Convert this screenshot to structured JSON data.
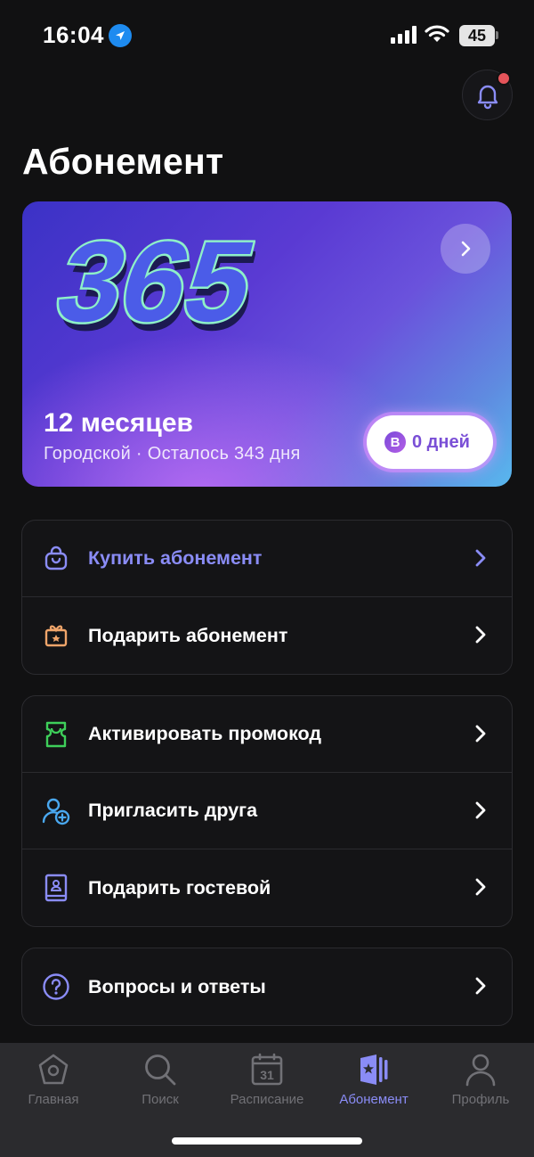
{
  "status_bar": {
    "time": "16:04",
    "battery": "45"
  },
  "page": {
    "title": "Абонемент"
  },
  "subscription_card": {
    "logo_text": "365",
    "title": "12 месяцев",
    "subtitle": "Городской · Осталось 343 дня",
    "badge_letter": "B",
    "days_label": "0 дней"
  },
  "menu_groups": [
    {
      "items": [
        {
          "label": "Купить абонемент",
          "icon": "shopping-bag-icon"
        },
        {
          "label": "Подарить абонемент",
          "icon": "gift-icon"
        }
      ]
    },
    {
      "items": [
        {
          "label": "Активировать промокод",
          "icon": "ticket-icon"
        },
        {
          "label": "Пригласить друга",
          "icon": "add-friend-icon"
        },
        {
          "label": "Подарить гостевой",
          "icon": "guest-pass-icon"
        }
      ]
    },
    {
      "items": [
        {
          "label": "Вопросы и ответы",
          "icon": "question-icon"
        }
      ]
    }
  ],
  "tab_bar": {
    "tabs": [
      {
        "label": "Главная",
        "icon": "home-icon"
      },
      {
        "label": "Поиск",
        "icon": "search-icon"
      },
      {
        "label": "Расписание",
        "icon": "calendar-icon",
        "icon_text": "31"
      },
      {
        "label": "Абонемент",
        "icon": "subscription-icon"
      },
      {
        "label": "Профиль",
        "icon": "profile-icon"
      }
    ],
    "active_index": 3
  },
  "colors": {
    "accent": "#8a8cf6",
    "background": "#111112",
    "notification_dot": "#e5545a",
    "gift_icon": "#f0a56a",
    "ticket_icon": "#3ecf5a",
    "friend_icon": "#4aa8f0"
  }
}
